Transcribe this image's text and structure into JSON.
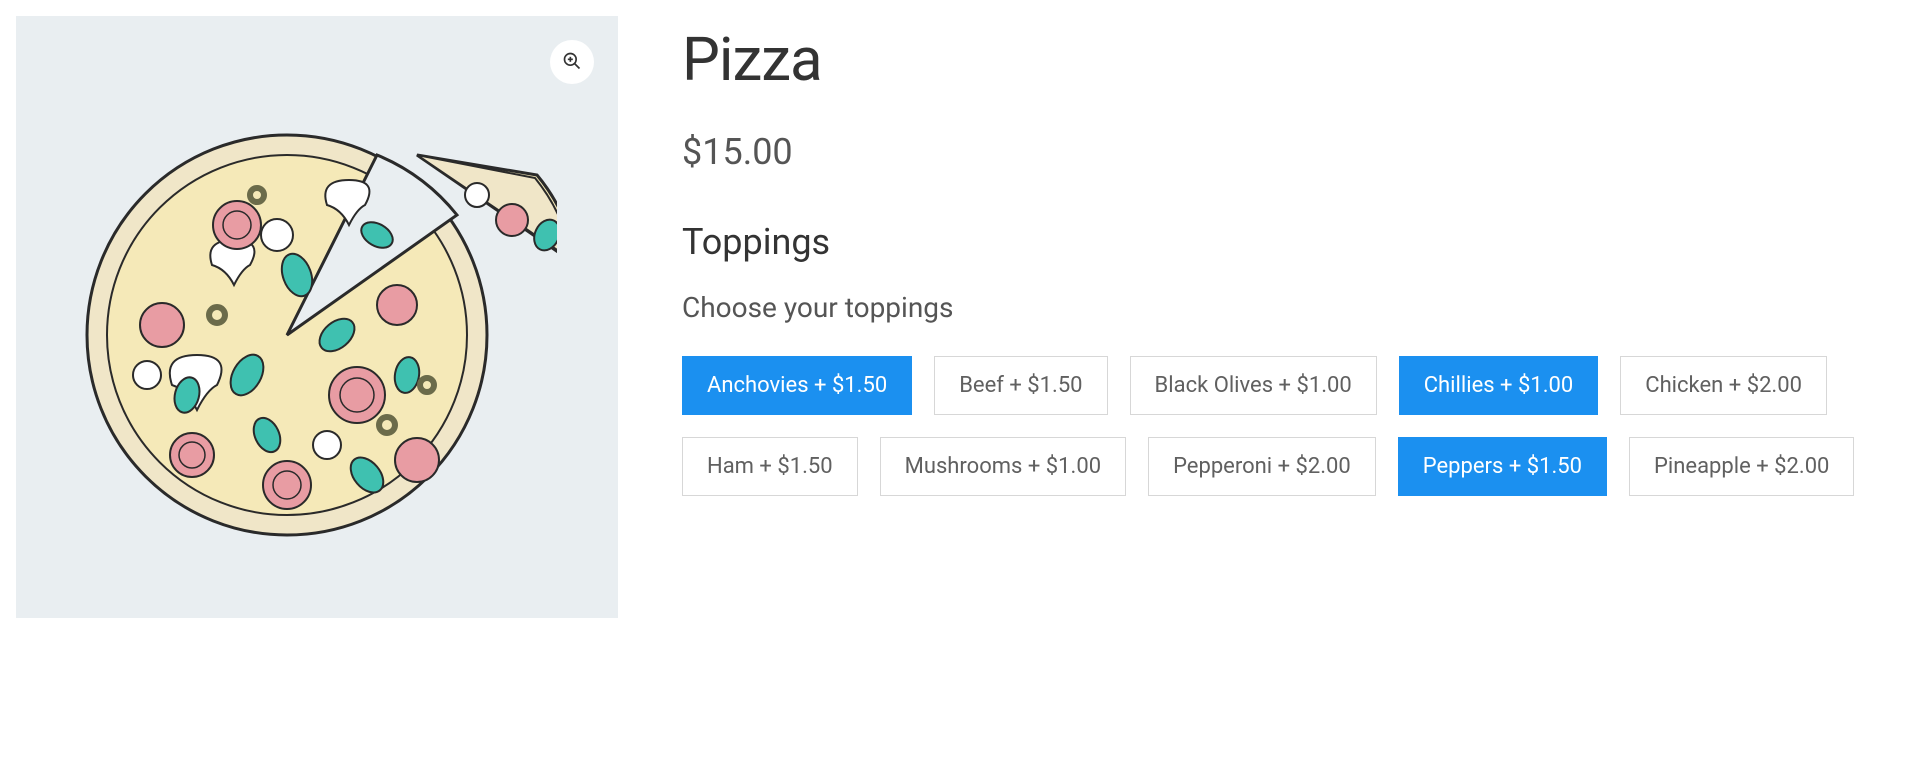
{
  "product": {
    "title": "Pizza",
    "price": "$15.00"
  },
  "toppings_section": {
    "heading": "Toppings",
    "subheading": "Choose your toppings"
  },
  "toppings": [
    {
      "label": "Anchovies + $1.50",
      "selected": true
    },
    {
      "label": "Beef + $1.50",
      "selected": false
    },
    {
      "label": "Black Olives + $1.00",
      "selected": false
    },
    {
      "label": "Chillies + $1.00",
      "selected": true
    },
    {
      "label": "Chicken + $2.00",
      "selected": false
    },
    {
      "label": "Ham + $1.50",
      "selected": false
    },
    {
      "label": "Mushrooms + $1.00",
      "selected": false
    },
    {
      "label": "Pepperoni + $2.00",
      "selected": false
    },
    {
      "label": "Peppers + $1.50",
      "selected": true
    },
    {
      "label": "Pineapple + $2.00",
      "selected": false
    }
  ],
  "icons": {
    "zoom": "zoom-in-icon"
  },
  "colors": {
    "accent": "#1b90f0",
    "image_bg": "#e9eef1",
    "border": "#d7d7d7",
    "text_primary": "#333333",
    "text_secondary": "#555555"
  }
}
